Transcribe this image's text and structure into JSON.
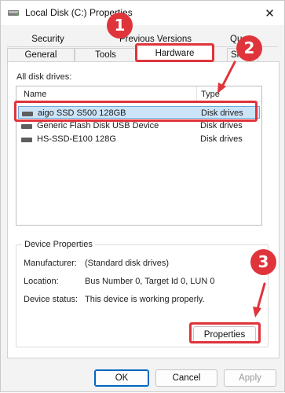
{
  "window": {
    "title": "Local Disk (C:) Properties",
    "close_glyph": "✕",
    "icon": "drive-icon"
  },
  "tabs": {
    "row1": [
      "Security",
      "Previous Versions",
      "Quota"
    ],
    "row2": [
      "General",
      "Tools",
      "Hardware",
      "Sharing"
    ],
    "active": "Hardware"
  },
  "drives": {
    "section_label": "All disk drives:",
    "columns": [
      "Name",
      "Type"
    ],
    "rows": [
      {
        "name": "aigo SSD S500 128GB",
        "type": "Disk drives",
        "selected": true
      },
      {
        "name": "Generic Flash Disk USB Device",
        "type": "Disk drives",
        "selected": false
      },
      {
        "name": "HS-SSD-E100 128G",
        "type": "Disk drives",
        "selected": false
      }
    ]
  },
  "device_properties": {
    "title": "Device Properties",
    "manufacturer_label": "Manufacturer:",
    "manufacturer_value": "(Standard disk drives)",
    "location_label": "Location:",
    "location_value": "Bus Number 0, Target Id 0, LUN 0",
    "status_label": "Device status:",
    "status_value": "This device is working properly.",
    "properties_button": "Properties"
  },
  "footer": {
    "ok": "OK",
    "cancel": "Cancel",
    "apply": "Apply"
  },
  "annotations": {
    "badge1": "1",
    "badge2": "2",
    "badge3": "3",
    "highlight_color": "#e0343b"
  }
}
